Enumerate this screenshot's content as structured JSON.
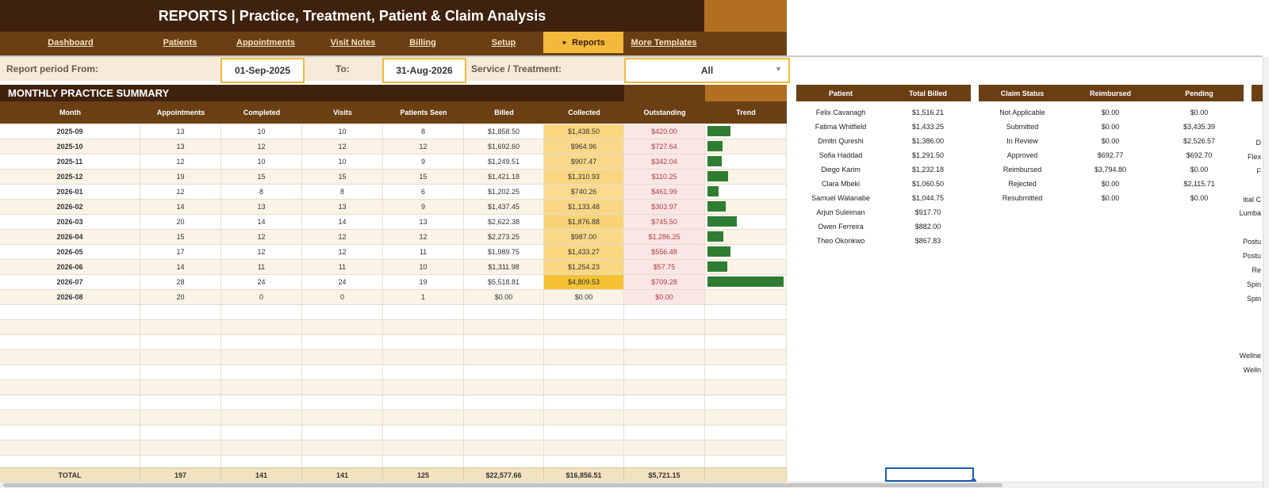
{
  "title": "REPORTS  |  Practice, Treatment, Patient & Claim Analysis",
  "nav": [
    {
      "label": "Dashboard",
      "active": false
    },
    {
      "label": "Patients",
      "active": false
    },
    {
      "label": "Appointments",
      "active": false
    },
    {
      "label": "Visit Notes",
      "active": false
    },
    {
      "label": "Billing",
      "active": false
    },
    {
      "label": "Setup",
      "active": false
    },
    {
      "label": "Reports",
      "active": true
    },
    {
      "label": "More Templates",
      "active": false
    }
  ],
  "filters": {
    "period_label": "Report period  From:",
    "from": "01-Sep-2025",
    "to_label": "To:",
    "to": "31-Aug-2026",
    "service_label": "Service / Treatment:",
    "service": "All"
  },
  "summary": {
    "heading": "MONTHLY PRACTICE SUMMARY",
    "columns": [
      "Month",
      "Appointments",
      "Completed",
      "Visits",
      "Patients Seen",
      "Billed",
      "Collected",
      "Outstanding",
      "Trend"
    ],
    "rows": [
      {
        "month": "2025-09",
        "appointments": "13",
        "completed": "10",
        "visits": "10",
        "patients": "8",
        "billed": "$1,858.50",
        "collected": "$1,438.50",
        "outstanding": "$420.00",
        "trend": 0.3
      },
      {
        "month": "2025-10",
        "appointments": "13",
        "completed": "12",
        "visits": "12",
        "patients": "12",
        "billed": "$1,692.60",
        "collected": "$964.96",
        "outstanding": "$727.64",
        "trend": 0.2
      },
      {
        "month": "2025-11",
        "appointments": "12",
        "completed": "10",
        "visits": "10",
        "patients": "9",
        "billed": "$1,249.51",
        "collected": "$907.47",
        "outstanding": "$342.04",
        "trend": 0.19
      },
      {
        "month": "2025-12",
        "appointments": "19",
        "completed": "15",
        "visits": "15",
        "patients": "15",
        "billed": "$1,421.18",
        "collected": "$1,310.93",
        "outstanding": "$110.25",
        "trend": 0.27
      },
      {
        "month": "2026-01",
        "appointments": "12",
        "completed": "8",
        "visits": "8",
        "patients": "6",
        "billed": "$1,202.25",
        "collected": "$740.26",
        "outstanding": "$461.99",
        "trend": 0.15
      },
      {
        "month": "2026-02",
        "appointments": "14",
        "completed": "13",
        "visits": "13",
        "patients": "9",
        "billed": "$1,437.45",
        "collected": "$1,133.48",
        "outstanding": "$303.97",
        "trend": 0.24
      },
      {
        "month": "2026-03",
        "appointments": "20",
        "completed": "14",
        "visits": "14",
        "patients": "13",
        "billed": "$2,622.38",
        "collected": "$1,876.88",
        "outstanding": "$745.50",
        "trend": 0.39
      },
      {
        "month": "2026-04",
        "appointments": "15",
        "completed": "12",
        "visits": "12",
        "patients": "12",
        "billed": "$2,273.25",
        "collected": "$987.00",
        "outstanding": "$1,286.25",
        "trend": 0.21
      },
      {
        "month": "2026-05",
        "appointments": "17",
        "completed": "12",
        "visits": "12",
        "patients": "11",
        "billed": "$1,989.75",
        "collected": "$1,433.27",
        "outstanding": "$556.48",
        "trend": 0.3
      },
      {
        "month": "2026-06",
        "appointments": "14",
        "completed": "11",
        "visits": "11",
        "patients": "10",
        "billed": "$1,311.98",
        "collected": "$1,254.23",
        "outstanding": "$57.75",
        "trend": 0.26
      },
      {
        "month": "2026-07",
        "appointments": "28",
        "completed": "24",
        "visits": "24",
        "patients": "19",
        "billed": "$5,518.81",
        "collected": "$4,809.53",
        "outstanding": "$709.28",
        "trend": 1.0
      },
      {
        "month": "2026-08",
        "appointments": "20",
        "completed": "0",
        "visits": "0",
        "patients": "1",
        "billed": "$0.00",
        "collected": "$0.00",
        "outstanding": "$0.00",
        "trend": 0
      }
    ],
    "total": {
      "label": "TOTAL",
      "appointments": "197",
      "completed": "141",
      "visits": "141",
      "patients": "125",
      "billed": "$22,577.66",
      "collected": "$16,856.51",
      "outstanding": "$5,721.15"
    }
  },
  "patients_table": {
    "columns": [
      "Patient",
      "Total Billed"
    ],
    "rows": [
      {
        "name": "Felix Cavanagh",
        "billed": "$1,516.21"
      },
      {
        "name": "Fatima Whitfield",
        "billed": "$1,433.25"
      },
      {
        "name": "Dmitri Qureshi",
        "billed": "$1,386.00"
      },
      {
        "name": "Sofia Haddad",
        "billed": "$1,291.50"
      },
      {
        "name": "Diego Karim",
        "billed": "$1,232.18"
      },
      {
        "name": "Clara Mbeki",
        "billed": "$1,060.50"
      },
      {
        "name": "Samuel Watanabe",
        "billed": "$1,044.75"
      },
      {
        "name": "Arjun Suleiman",
        "billed": "$917.70"
      },
      {
        "name": "Owen Ferreira",
        "billed": "$882.00"
      },
      {
        "name": "Theo Okonkwo",
        "billed": "$867.83"
      }
    ]
  },
  "claims_table": {
    "columns": [
      "Claim Status",
      "Reimbursed",
      "Pending"
    ],
    "rows": [
      {
        "status": "Not Applicable",
        "reimbursed": "$0.00",
        "pending": "$0.00"
      },
      {
        "status": "Submitted",
        "reimbursed": "$0.00",
        "pending": "$3,435.39"
      },
      {
        "status": "In Review",
        "reimbursed": "$0.00",
        "pending": "$2,526.57"
      },
      {
        "status": "Approved",
        "reimbursed": "$692.77",
        "pending": "$692.70"
      },
      {
        "status": "Reimbursed",
        "reimbursed": "$3,794.80",
        "pending": "$0.00"
      },
      {
        "status": "Rejected",
        "reimbursed": "$0.00",
        "pending": "$2,115.71"
      },
      {
        "status": "Resubmitted",
        "reimbursed": "$0.00",
        "pending": "$0.00"
      }
    ]
  },
  "cut_off_text": [
    "D",
    "Flex",
    "F",
    "itial C",
    "Lumba",
    "Postu",
    "Postu",
    "Re",
    "Spin",
    "Spin",
    "Wellne",
    "Welln"
  ],
  "colors": {
    "dark_brown": "#3f220e",
    "mid_brown": "#6b3f14",
    "gold": "#f2b93c",
    "bar_green": "#2f7d32",
    "outstanding_red": "#b03a3a"
  }
}
